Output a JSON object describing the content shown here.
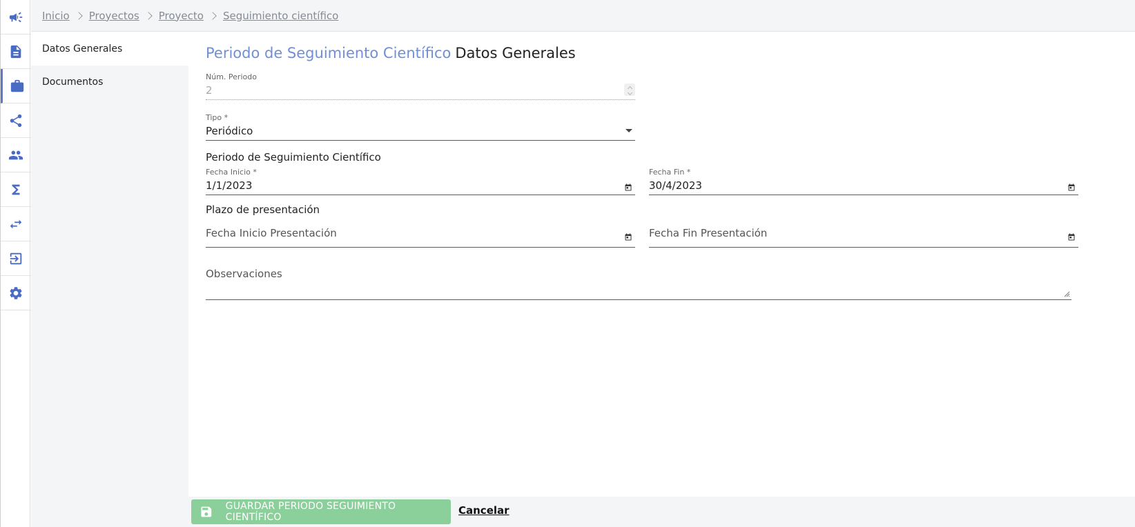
{
  "breadcrumb": [
    "Inicio",
    "Proyectos",
    "Proyecto",
    "Seguimiento científico"
  ],
  "rail": {
    "items": [
      {
        "icon": "megaphone-icon"
      },
      {
        "icon": "document-icon"
      },
      {
        "icon": "briefcase-icon"
      },
      {
        "icon": "share-icon"
      },
      {
        "icon": "people-icon"
      },
      {
        "icon": "sigma-icon"
      },
      {
        "icon": "swap-icon"
      },
      {
        "icon": "logout-icon"
      },
      {
        "icon": "gear-icon"
      }
    ],
    "active_index": 2
  },
  "sidemenu": {
    "items": [
      {
        "label": "Datos Generales"
      },
      {
        "label": "Documentos"
      }
    ]
  },
  "heading": {
    "entity": "Periodo de Seguimiento Científico",
    "section": "Datos Generales"
  },
  "form": {
    "num_periodo": {
      "label": "Núm. Periodo",
      "value": "2"
    },
    "tipo": {
      "label": "Tipo *",
      "value": "Periódico"
    },
    "periodo_title": "Periodo de Seguimiento Científico",
    "fecha_inicio": {
      "label": "Fecha Inicio *",
      "value": "1/1/2023"
    },
    "fecha_fin": {
      "label": "Fecha Fin *",
      "value": "30/4/2023"
    },
    "plazo_title": "Plazo de presentación",
    "fecha_inicio_presentacion": {
      "placeholder": "Fecha Inicio Presentación"
    },
    "fecha_fin_presentacion": {
      "placeholder": "Fecha Fin Presentación"
    },
    "observaciones": {
      "placeholder": "Observaciones"
    }
  },
  "actions": {
    "save_label": "GUARDAR PERIODO SEGUIMIENTO CIENTÍFICO",
    "cancel_label": "Cancelar"
  },
  "colors": {
    "accent": "#4a6bc4",
    "heading_link": "#6f8fd6",
    "save_button": "#8bd09a"
  }
}
